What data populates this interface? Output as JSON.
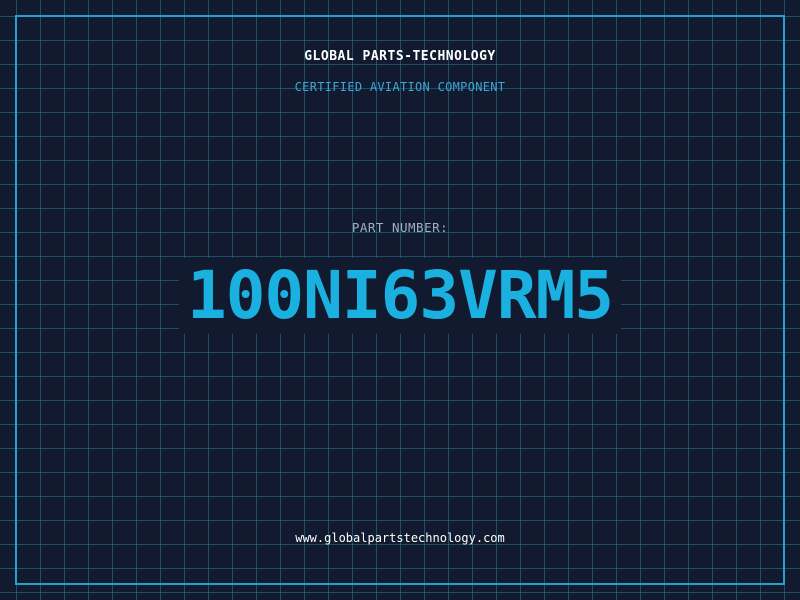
{
  "header": {
    "company_name": "GLOBAL PARTS-TECHNOLOGY",
    "subtitle": "CERTIFIED AVIATION COMPONENT"
  },
  "part": {
    "label": "PART NUMBER:",
    "number": "100NI63VRM5"
  },
  "footer": {
    "website": "www.globalpartstechnology.com"
  },
  "colors": {
    "background": "#111a2e",
    "grid": "#2a7896",
    "frame": "#1fa3cc",
    "accent": "#1ab0e0",
    "subtitle": "#3fa6d6",
    "label": "#9fb0c4",
    "text": "#ffffff"
  }
}
